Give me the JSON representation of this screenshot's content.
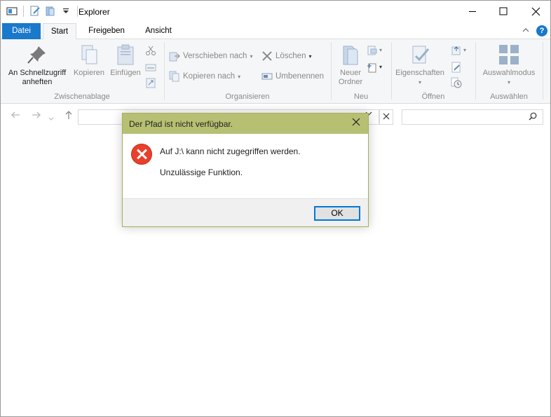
{
  "window": {
    "title": "Explorer",
    "controls": {
      "minimize": "—",
      "maximize": "☐",
      "close": "✕"
    }
  },
  "tabs": [
    {
      "label": "Datei"
    },
    {
      "label": "Start"
    },
    {
      "label": "Freigeben"
    },
    {
      "label": "Ansicht"
    }
  ],
  "ribbon": {
    "clipboard": {
      "label": "Zwischenablage",
      "pin_line1": "An Schnellzugriff",
      "pin_line2": "anheften",
      "copy": "Kopieren",
      "paste": "Einfügen"
    },
    "organize": {
      "label": "Organisieren",
      "move_to": "Verschieben nach",
      "copy_to": "Kopieren nach",
      "delete": "Löschen",
      "rename": "Umbenennen"
    },
    "new": {
      "label": "Neu",
      "new_folder_line1": "Neuer",
      "new_folder_line2": "Ordner"
    },
    "open": {
      "label": "Öffnen",
      "properties": "Eigenschaften"
    },
    "select": {
      "label": "Auswählen",
      "selection_mode": "Auswahlmodus"
    }
  },
  "dialog": {
    "title": "Der Pfad ist nicht verfügbar.",
    "message": "Auf J:\\ kann nicht zugegriffen werden.",
    "detail": "Unzulässige Funktion.",
    "ok_label": "OK"
  },
  "colors": {
    "accent": "#1979ca",
    "dialog_title_bg": "#b7c072",
    "error_red": "#e8402c"
  }
}
